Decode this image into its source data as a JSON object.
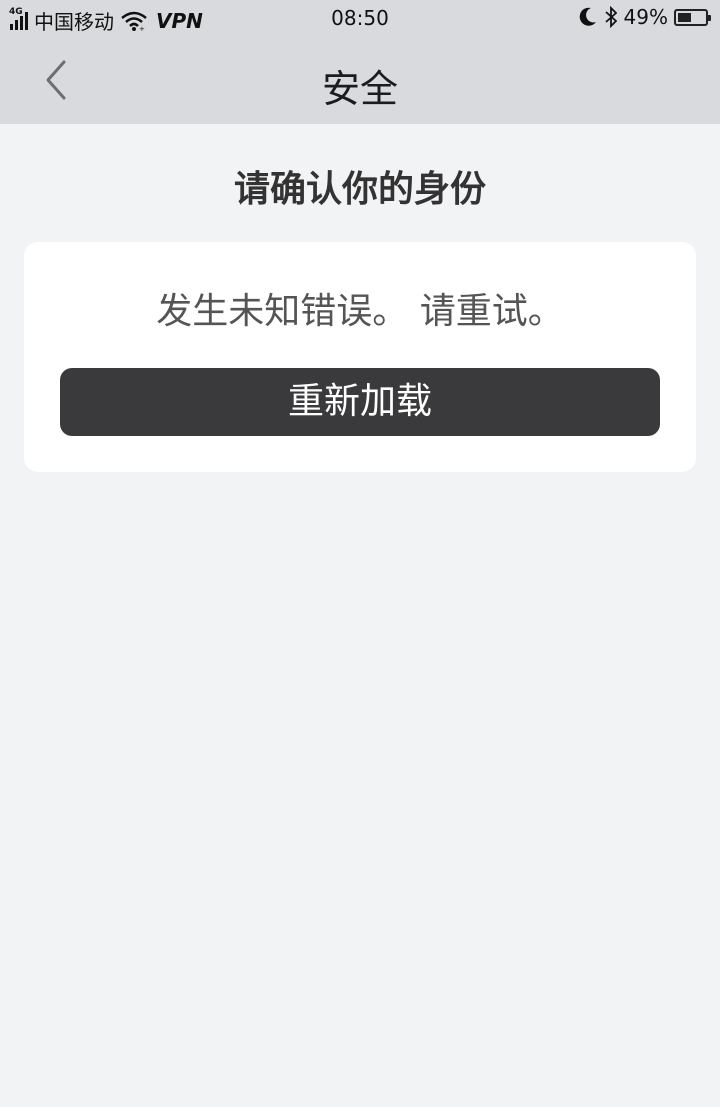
{
  "status_bar": {
    "network_type": "4G",
    "carrier": "中国移动",
    "vpn": "VPN",
    "time": "08:50",
    "battery_percent": "49%",
    "battery_level": 0.49,
    "icons": [
      "signal-icon",
      "wifi-icon",
      "moon-icon",
      "bluetooth-icon",
      "battery-icon"
    ]
  },
  "nav": {
    "title": "安全",
    "back_icon": "chevron-left-icon"
  },
  "main": {
    "heading": "请确认你的身份",
    "error_message": "发生未知错误。 请重试。",
    "reload_button": "重新加载"
  },
  "colors": {
    "top_bar": "#d8dadd",
    "page_background": "#f2f3f5",
    "card": "#ffffff",
    "button": "#3a3a3c"
  }
}
